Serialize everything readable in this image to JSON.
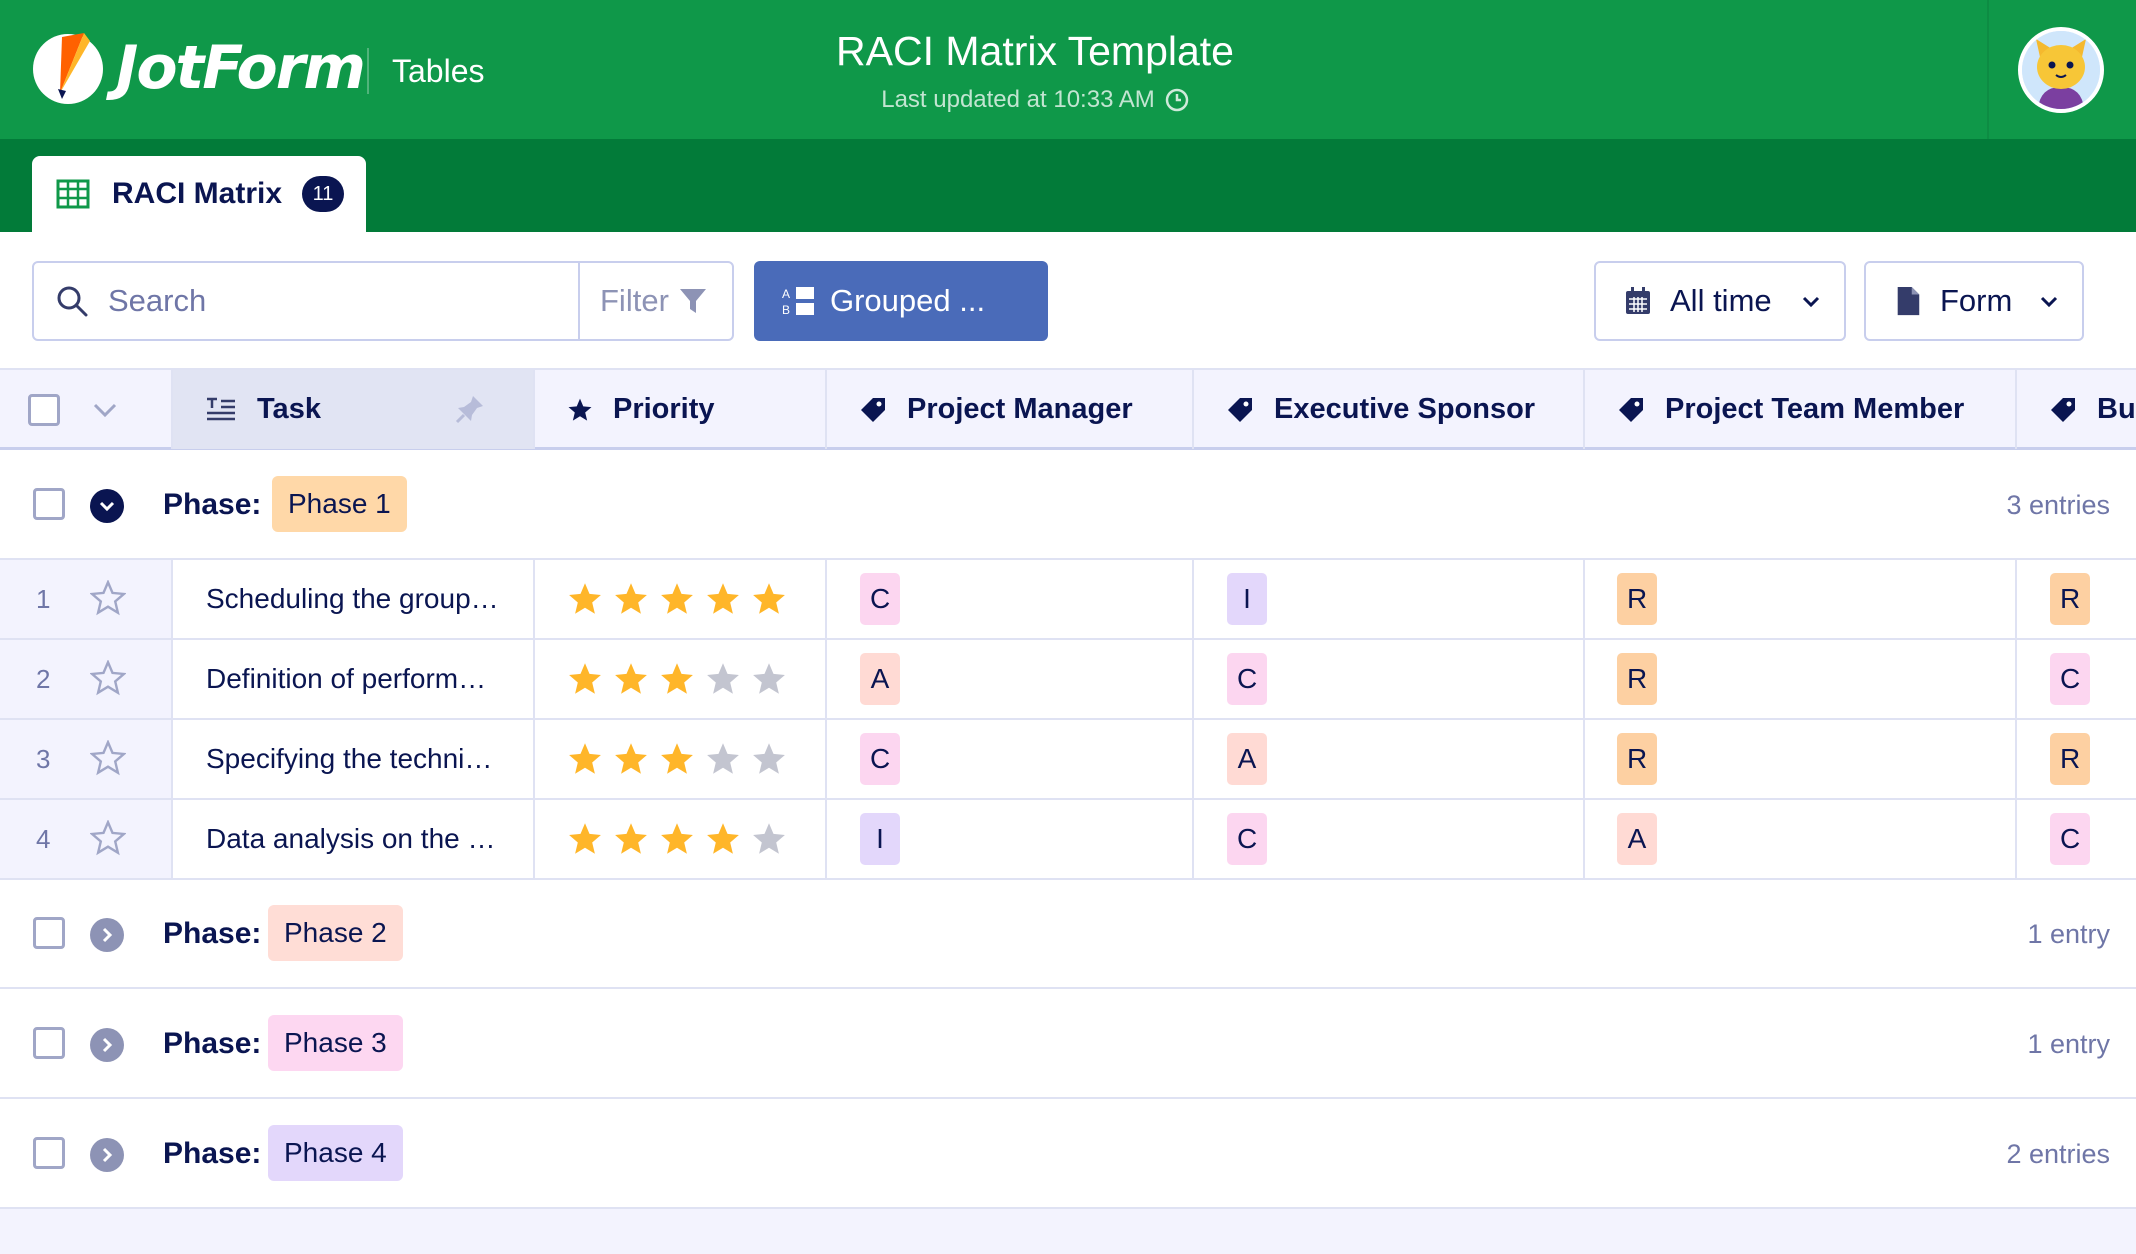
{
  "header": {
    "brand": "JotForm",
    "app_name": "Tables",
    "title": "RACI Matrix Template",
    "subtitle": "Last updated at 10:33 AM"
  },
  "tab": {
    "label": "RACI Matrix",
    "count": "11"
  },
  "toolbar": {
    "search_placeholder": "Search",
    "filter_label": "Filter",
    "grouped_label": "Grouped ...",
    "time_label": "All time",
    "form_label": "Form"
  },
  "columns": {
    "task": "Task",
    "priority": "Priority",
    "project_manager": "Project Manager",
    "executive_sponsor": "Executive Sponsor",
    "project_team_member": "Project Team Member",
    "business": "Bus"
  },
  "colors": {
    "header_green": "#0f9849",
    "tab_green": "#027b39",
    "grouped_blue": "#4a6bb9",
    "star_on": "#ffb629",
    "star_off": "#c3c5d0",
    "raci_C": "#fcd6f0",
    "raci_I": "#e3d7fb",
    "raci_R": "#fdd0a2",
    "raci_A": "#ffdad4"
  },
  "groups": [
    {
      "label": "Phase:",
      "value": "Phase 1",
      "color": "#ffd8a8",
      "count": "3 entries",
      "expanded": true
    },
    {
      "label": "Phase:",
      "value": "Phase 2",
      "color": "#ffddd6",
      "count": "1 entry",
      "expanded": false
    },
    {
      "label": "Phase:",
      "value": "Phase 3",
      "color": "#fdd7f1",
      "count": "1 entry",
      "expanded": false
    },
    {
      "label": "Phase:",
      "value": "Phase 4",
      "color": "#e3d7fb",
      "count": "2 entries",
      "expanded": false
    }
  ],
  "rows": [
    {
      "num": "1",
      "task": "Scheduling the group…",
      "priority": 5,
      "pm": "C",
      "es": "I",
      "ptm": "R",
      "bus": "R"
    },
    {
      "num": "2",
      "task": "Definition of perform…",
      "priority": 3,
      "pm": "A",
      "es": "C",
      "ptm": "R",
      "bus": "C"
    },
    {
      "num": "3",
      "task": "Specifying the techni…",
      "priority": 3,
      "pm": "C",
      "es": "A",
      "ptm": "R",
      "bus": "R"
    },
    {
      "num": "4",
      "task": "Data analysis on the …",
      "priority": 4,
      "pm": "I",
      "es": "C",
      "ptm": "A",
      "bus": "C"
    }
  ]
}
